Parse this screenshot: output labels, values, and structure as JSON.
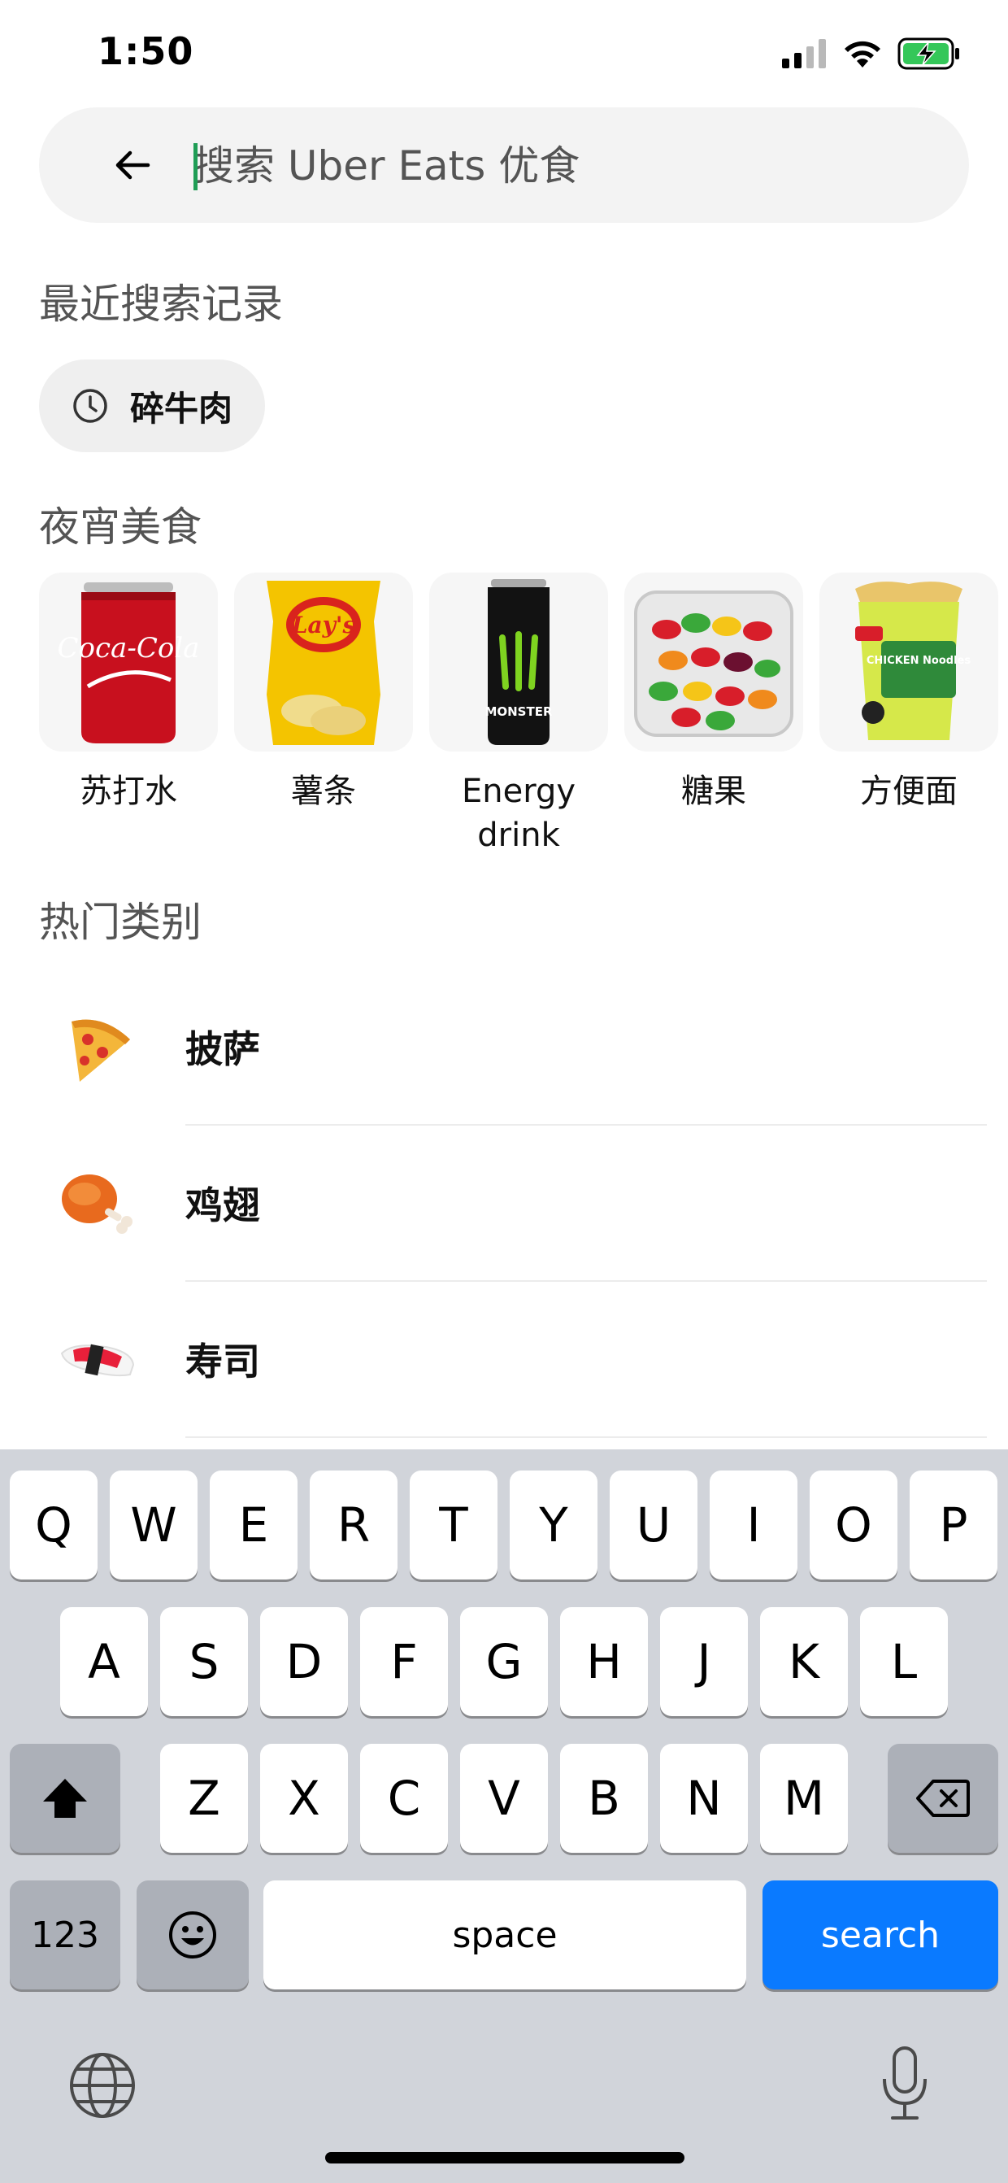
{
  "status_bar": {
    "time": "1:50"
  },
  "search": {
    "placeholder": "搜索 Uber Eats 优食"
  },
  "recent": {
    "title": "最近搜索记录",
    "items": [
      {
        "label": "碎牛肉",
        "icon": "clock-icon"
      }
    ]
  },
  "late_night": {
    "title": "夜宵美食",
    "items": [
      {
        "label": "苏打水",
        "icon": "soda-can-icon",
        "product_text": "Coca-Cola"
      },
      {
        "label": "薯条",
        "icon": "chips-bag-icon",
        "product_text": "Lay's"
      },
      {
        "label": "Energy drink",
        "icon": "energy-drink-icon",
        "product_text": "MONSTER"
      },
      {
        "label": "糖果",
        "icon": "candy-tub-icon"
      },
      {
        "label": "方便面",
        "icon": "noodle-cup-icon",
        "product_text": "CHICKEN Noodles"
      }
    ]
  },
  "categories": {
    "title": "热门类别",
    "items": [
      {
        "label": "披萨",
        "icon": "pizza-icon"
      },
      {
        "label": "鸡翅",
        "icon": "chicken-wing-icon"
      },
      {
        "label": "寿司",
        "icon": "sushi-icon"
      }
    ]
  },
  "keyboard": {
    "row1": [
      "Q",
      "W",
      "E",
      "R",
      "T",
      "Y",
      "U",
      "I",
      "O",
      "P"
    ],
    "row2": [
      "A",
      "S",
      "D",
      "F",
      "G",
      "H",
      "J",
      "K",
      "L"
    ],
    "row3": [
      "Z",
      "X",
      "C",
      "V",
      "B",
      "N",
      "M"
    ],
    "numbers_label": "123",
    "space_label": "space",
    "search_label": "search"
  },
  "colors": {
    "accent_blue": "#0a7aff",
    "cursor_green": "#1f9d55",
    "battery_green": "#34c759"
  }
}
